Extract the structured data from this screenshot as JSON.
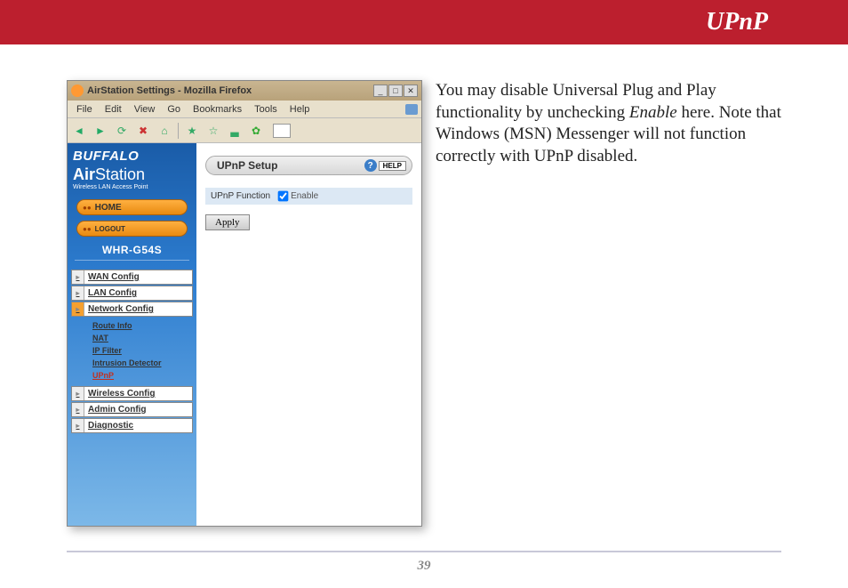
{
  "banner": {
    "title": "UPnP"
  },
  "browser": {
    "title": "AirStation Settings - Mozilla Firefox",
    "menus": [
      "File",
      "Edit",
      "View",
      "Go",
      "Bookmarks",
      "Tools",
      "Help"
    ]
  },
  "sidebar": {
    "brand": "BUFFALO",
    "product1": "Air",
    "product2": "Station",
    "subtitle": "Wireless LAN Access Point",
    "home": "HOME",
    "logout": "LOGOUT",
    "model": "WHR-G54S",
    "items": [
      {
        "label": "WAN Config",
        "active": false
      },
      {
        "label": "LAN Config",
        "active": false
      },
      {
        "label": "Network Config",
        "active": true
      }
    ],
    "subitems": [
      {
        "label": "Route Info",
        "active": false
      },
      {
        "label": "NAT",
        "active": false
      },
      {
        "label": "IP Filter",
        "active": false
      },
      {
        "label": "Intrusion Detector",
        "active": false
      },
      {
        "label": "UPnP",
        "active": true
      }
    ],
    "items2": [
      {
        "label": "Wireless Config"
      },
      {
        "label": "Admin Config"
      },
      {
        "label": "Diagnostic"
      }
    ]
  },
  "content": {
    "setup_title": "UPnP Setup",
    "help": "HELP",
    "func_label": "UPnP Function",
    "enable_label": "Enable",
    "enabled": true,
    "apply": "Apply"
  },
  "explain": {
    "p1a": "You may disable Universal Plug and Play functionality by unchecking ",
    "p1b": "Enable",
    "p1c": " here.  Note that Windows (MSN) Messenger will not function correctly with UPnP disabled."
  },
  "page_number": "39"
}
